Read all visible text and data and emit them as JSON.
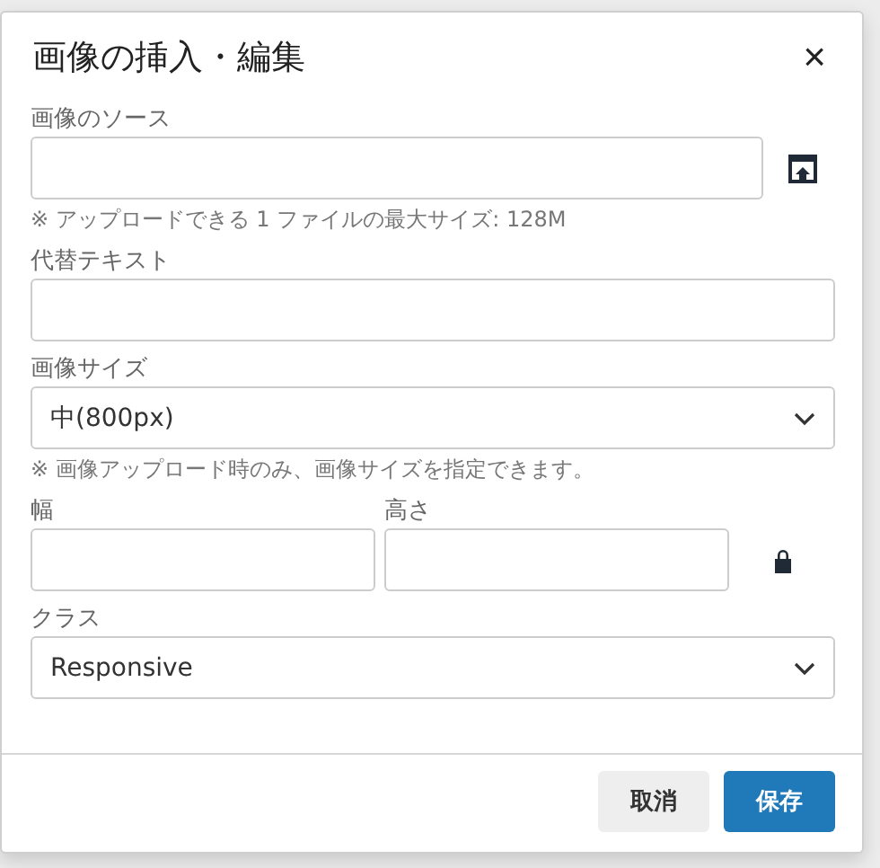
{
  "dialog": {
    "title": "画像の挿入・編集",
    "close": "×",
    "source": {
      "label": "画像のソース"
    },
    "source_note": "※ アップロードできる 1 ファイルの最大サイズ: 128M",
    "alt": {
      "label": "代替テキスト"
    },
    "size": {
      "label": "画像サイズ",
      "value": "中(800px)"
    },
    "size_note": "※ 画像アップロード時のみ、画像サイズを指定できます。",
    "width": {
      "label": "幅"
    },
    "height": {
      "label": "高さ"
    },
    "class": {
      "label": "クラス",
      "value": "Responsive"
    },
    "buttons": [
      {
        "label": "取消",
        "kind": "secondary"
      },
      {
        "label": "保存",
        "kind": "primary"
      }
    ]
  }
}
